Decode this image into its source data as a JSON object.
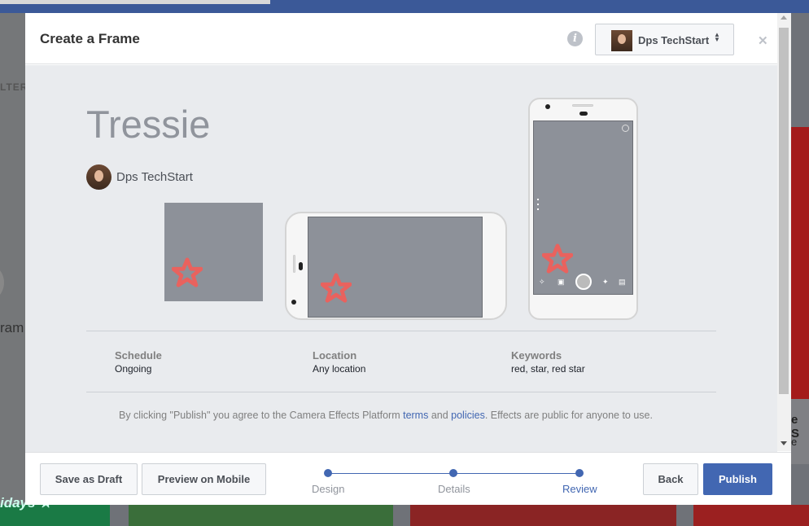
{
  "background": {
    "left_text_top": "LTERS",
    "left_text_bottom": "ram",
    "right_text_top": "e S",
    "right_text_bottom": "e",
    "bottom_left_text": "idays ★"
  },
  "modal": {
    "title": "Create a Frame",
    "account": {
      "name": "Dps TechStart",
      "avatar": "profile-photo"
    },
    "info_icon": "info-icon",
    "close_icon": "close-icon",
    "frame": {
      "title": "Tressie",
      "creator": "Dps TechStart"
    },
    "details": [
      {
        "label": "Schedule",
        "value": "Ongoing"
      },
      {
        "label": "Location",
        "value": "Any location"
      },
      {
        "label": "Keywords",
        "value": "red, star, red star"
      }
    ],
    "agreement": {
      "prefix": "By clicking \"Publish\" you agree to the Camera Effects Platform ",
      "terms_link": "terms",
      "middle": " and ",
      "policies_link": "policies",
      "suffix": ". Effects are public for anyone to use."
    },
    "footer": {
      "save_draft": "Save as Draft",
      "preview_mobile": "Preview on Mobile",
      "back": "Back",
      "publish": "Publish",
      "steps": [
        "Design",
        "Details",
        "Review"
      ],
      "active_step": "Review"
    }
  },
  "colors": {
    "accent": "#4267b2",
    "star": "#e9625e",
    "preview_bg": "#8d9199"
  }
}
